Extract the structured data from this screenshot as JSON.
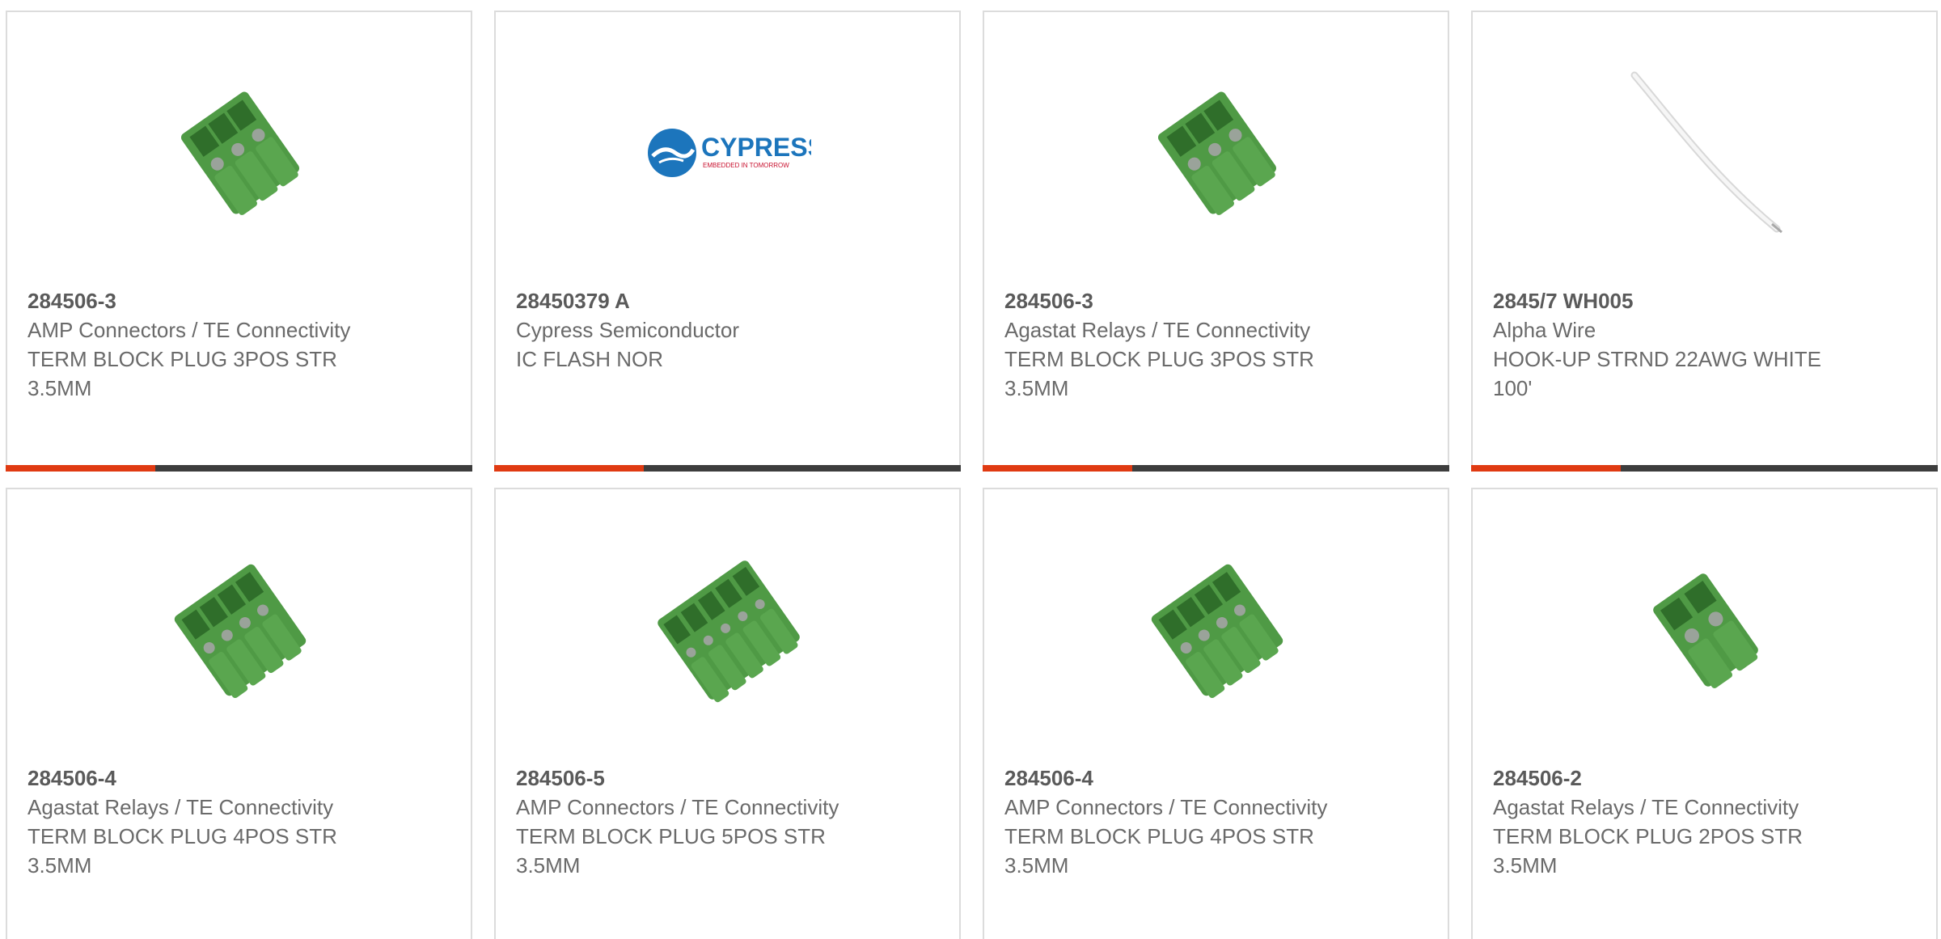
{
  "products": [
    {
      "part": "284506-3",
      "manufacturer": "AMP Connectors / TE Connectivity",
      "description": "TERM BLOCK PLUG 3POS STR 3.5MM",
      "image": "terminal-block-3pos-icon"
    },
    {
      "part": "28450379 A",
      "manufacturer": "Cypress Semiconductor",
      "description": "IC FLASH NOR",
      "image": "cypress-logo",
      "logo": {
        "name": "CYPRESS",
        "tagline": "EMBEDDED IN TOMORROW"
      }
    },
    {
      "part": "284506-3",
      "manufacturer": "Agastat Relays / TE Connectivity",
      "description": "TERM BLOCK PLUG 3POS STR 3.5MM",
      "image": "terminal-block-3pos-icon"
    },
    {
      "part": "2845/7 WH005",
      "manufacturer": "Alpha Wire",
      "description": "HOOK-UP STRND 22AWG WHITE 100'",
      "image": "white-wire-icon"
    },
    {
      "part": "284506-4",
      "manufacturer": "Agastat Relays / TE Connectivity",
      "description": "TERM BLOCK PLUG 4POS STR 3.5MM",
      "image": "terminal-block-4pos-icon"
    },
    {
      "part": "284506-5",
      "manufacturer": "AMP Connectors / TE Connectivity",
      "description": "TERM BLOCK PLUG 5POS STR 3.5MM",
      "image": "terminal-block-5pos-icon"
    },
    {
      "part": "284506-4",
      "manufacturer": "AMP Connectors / TE Connectivity",
      "description": "TERM BLOCK PLUG 4POS STR 3.5MM",
      "image": "terminal-block-4pos-icon"
    },
    {
      "part": "284506-2",
      "manufacturer": "Agastat Relays / TE Connectivity",
      "description": "TERM BLOCK PLUG 2POS STR 3.5MM",
      "image": "terminal-block-2pos-icon"
    }
  ],
  "colors": {
    "accent": "#e03a12",
    "bar": "#3d3d3d",
    "connector_green": "#4f9a45",
    "cypress_blue": "#1c75bc",
    "cypress_red": "#c8102e"
  }
}
